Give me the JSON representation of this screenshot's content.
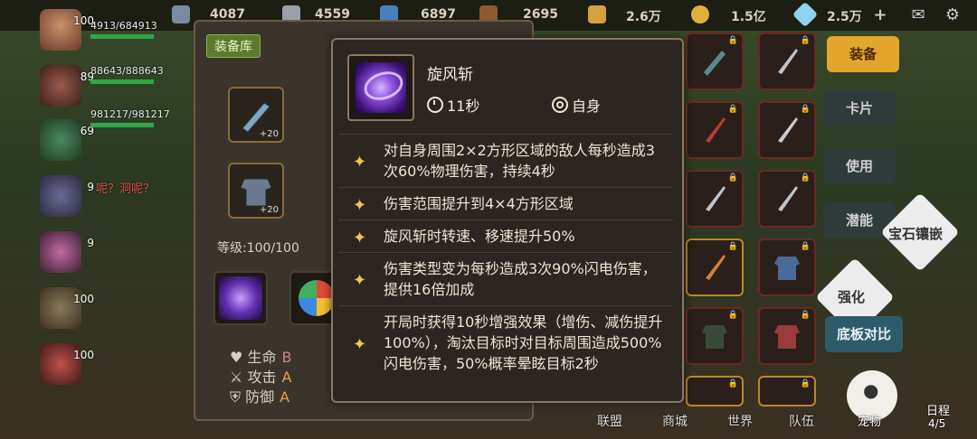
{
  "top_bar": {
    "resources": [
      "4087",
      "4559",
      "6897",
      "2695",
      "2.6万",
      "1.5亿",
      "2.5万"
    ],
    "plus": "+"
  },
  "heroes": {
    "hp": [
      "4913/684913",
      "88643/888643",
      "981217/981217"
    ],
    "levels": [
      "100",
      "89",
      "69",
      "9",
      "9",
      "100",
      "100"
    ],
    "chat": "呢？洞呢？"
  },
  "inventory": {
    "tab_label": "装备库",
    "level_text": "等级:100/100",
    "slot_plus": [
      "+20",
      "+20"
    ],
    "stats": [
      {
        "label": "生命",
        "grade": "B"
      },
      {
        "label": "攻击",
        "grade": "A"
      },
      {
        "label": "防御",
        "grade": "A"
      }
    ]
  },
  "tooltip": {
    "skill_name": "旋风斩",
    "cooldown": "11秒",
    "target": "自身",
    "effects": [
      "对自身周围2×2方形区域的敌人每秒造成3次60%物理伤害，持续4秒",
      "伤害范围提升到4×4方形区域",
      "旋风斩时转速、移速提升50%",
      "伤害类型变为每秒造成3次90%闪电伤害，提供16倍加成",
      "开局时获得10秒增强效果（增伤、减伤提升100%），淘汰目标时对目标周围造成500%闪电伤害，50%概率晕眩目标2秒"
    ]
  },
  "right_menu": {
    "equip": "装备",
    "card": "卡片",
    "use": "使用",
    "potential": "潜能",
    "gem": "宝石镶嵌",
    "enhance": "强化",
    "compare": "底板对比",
    "pet": "宠物",
    "schedule": "日程",
    "schedule_count": "4/5"
  },
  "bottom_nav": [
    "联盟",
    "商城",
    "世界",
    "队伍"
  ]
}
